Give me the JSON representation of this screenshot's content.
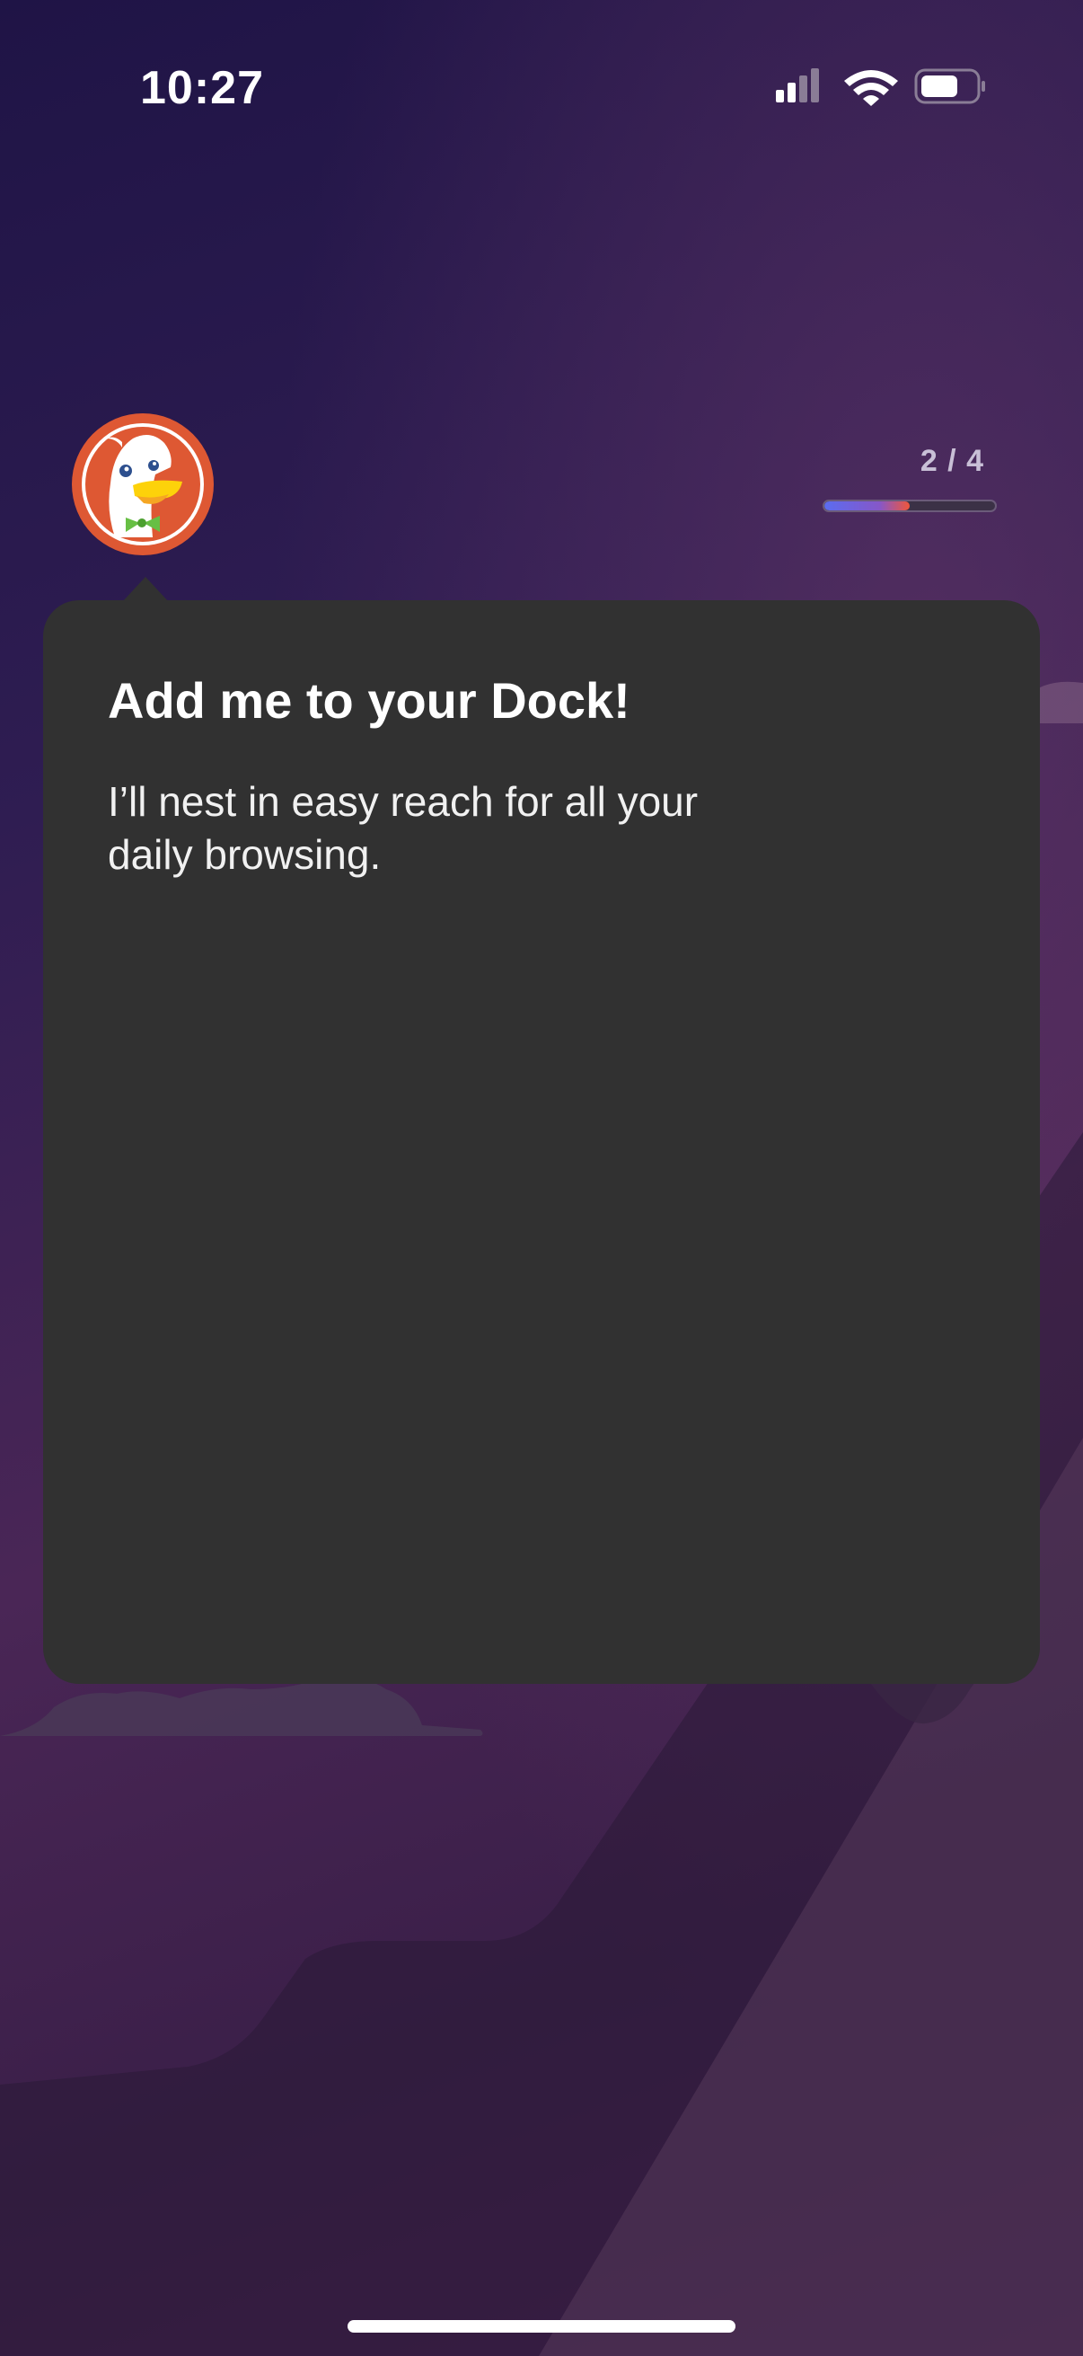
{
  "status_bar": {
    "time": "10:27",
    "icons": [
      "cellular-signal-icon",
      "wifi-icon",
      "battery-icon"
    ]
  },
  "header": {
    "logo_icon": "duckduckgo-logo-icon",
    "progress": {
      "label": "2 / 4",
      "current_step": 2,
      "total_steps": 4,
      "fill_fraction": 0.5
    }
  },
  "dialog": {
    "title": "Add me to your Dock!",
    "body": "I’ll nest in easy reach for all your daily browsing."
  },
  "colors": {
    "dialog_background": "#313131",
    "logo_orange": "#de5833",
    "progress_start": "#5b6cf0",
    "progress_end": "#f0573b"
  }
}
